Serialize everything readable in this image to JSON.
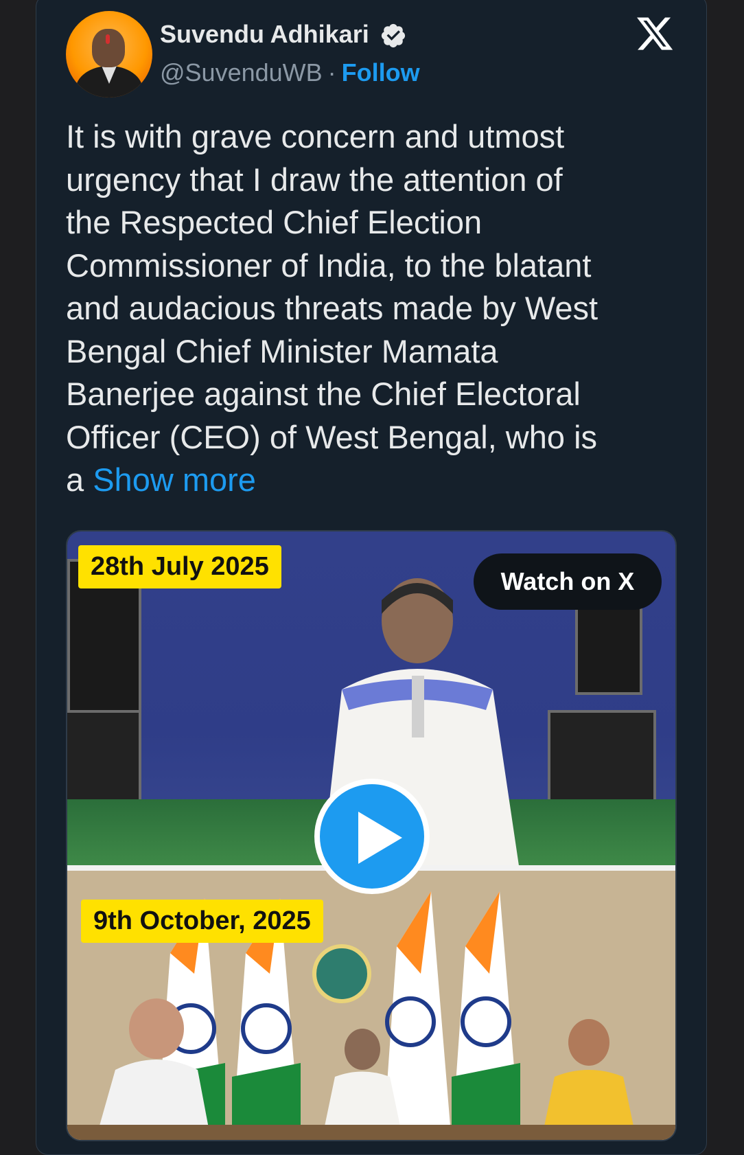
{
  "author": {
    "name": "Suvendu Adhikari",
    "handle": "@SuvenduWB",
    "separator": "·",
    "follow_label": "Follow"
  },
  "tweet": {
    "text": "It is with grave concern and utmost\nurgency that I draw the attention of\nthe Respected Chief Election\nCommissioner of India, to the blatant\nand audacious threats made by West\nBengal Chief Minister Mamata\nBanerjee against the Chief Electoral\nOfficer (CEO) of West Bengal, who is\na ",
    "show_more": "Show more"
  },
  "media": {
    "date_top": "28th July 2025",
    "date_bottom": "9th October, 2025",
    "watch_label": "Watch on X"
  },
  "colors": {
    "background": "#15202b",
    "accent": "#1d9bf0",
    "badge": "#ffe100"
  },
  "icons": [
    "verified-badge-icon",
    "x-logo-icon",
    "play-icon"
  ]
}
